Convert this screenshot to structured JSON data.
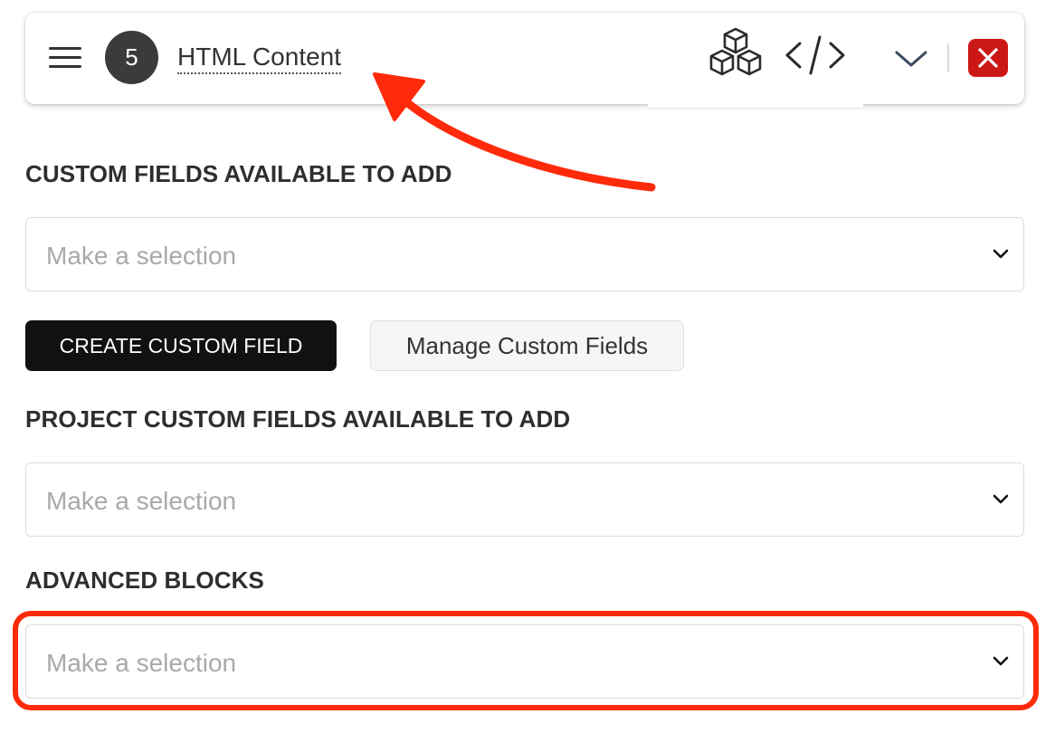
{
  "header": {
    "step_number": "5",
    "title": "HTML Content",
    "icons": [
      "menu-icon",
      "blocks-icon",
      "code-icon",
      "chevron-down-icon",
      "close-icon"
    ]
  },
  "sections": {
    "custom_fields": {
      "label": "CUSTOM FIELDS AVAILABLE TO ADD",
      "placeholder": "Make a selection"
    },
    "project_custom_fields": {
      "label": "PROJECT CUSTOM FIELDS AVAILABLE TO ADD",
      "placeholder": "Make a selection"
    },
    "advanced_blocks": {
      "label": "ADVANCED BLOCKS",
      "placeholder": "Make a selection"
    }
  },
  "buttons": {
    "create_custom_field": "CREATE CUSTOM FIELD",
    "manage_custom_fields": "Manage Custom Fields"
  },
  "colors": {
    "close_button": "#cc1717",
    "annotation": "#ff2a0a",
    "primary_button": "#111111"
  }
}
